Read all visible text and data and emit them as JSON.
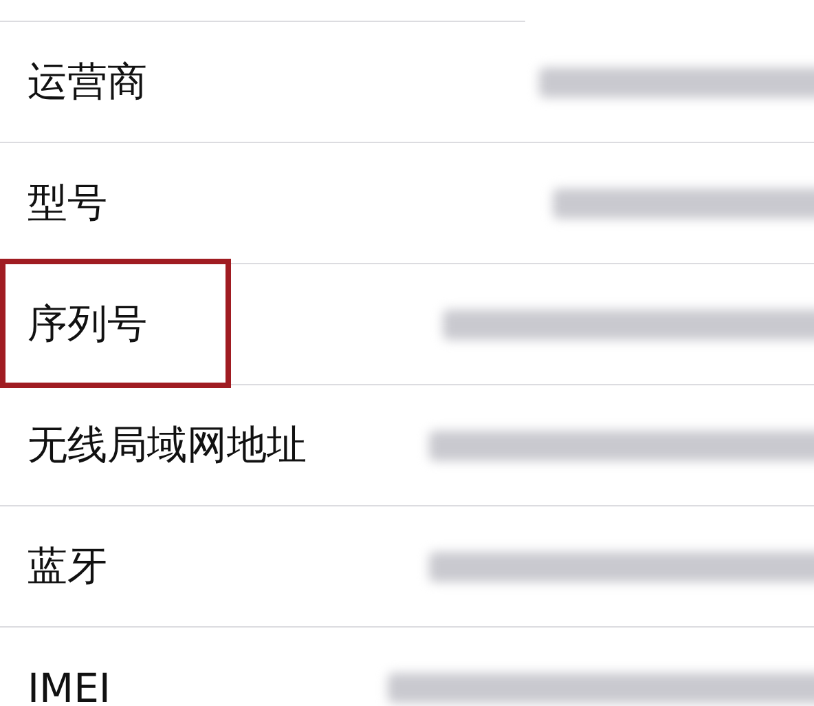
{
  "rows": [
    {
      "label": "运营商",
      "highlighted": false
    },
    {
      "label": "型号",
      "highlighted": false
    },
    {
      "label": "序列号",
      "highlighted": true
    },
    {
      "label": "无线局域网地址",
      "highlighted": false
    },
    {
      "label": "蓝牙",
      "highlighted": false
    },
    {
      "label": "IMEI",
      "highlighted": false
    }
  ]
}
